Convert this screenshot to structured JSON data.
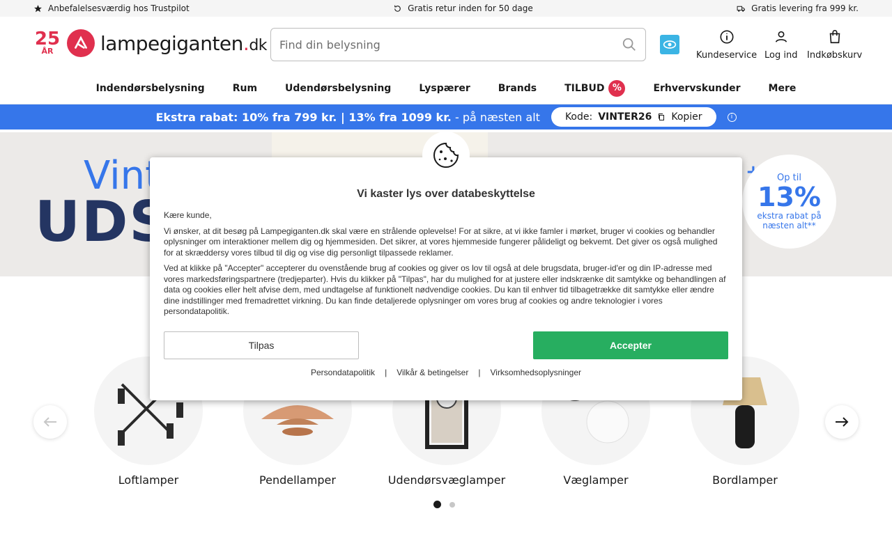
{
  "topbar": {
    "left": "Anbefalelsesværdig hos Trustpilot",
    "center": "Gratis retur inden for 50 dage",
    "right": "Gratis levering fra 999 kr."
  },
  "logo": {
    "years": "25",
    "years_sub": "ÅR",
    "name": "lampegiganten",
    "dot": ".",
    "tld": "dk"
  },
  "search": {
    "placeholder": "Find din belysning"
  },
  "header_links": {
    "customer_service": "Kundeservice",
    "login": "Log ind",
    "cart": "Indkøbskurv"
  },
  "nav": {
    "items": [
      "Indendørsbelysning",
      "Rum",
      "Udendørsbelysning",
      "Lyspærer",
      "Brands",
      "TILBUD",
      "Erhvervskunder",
      "Mere"
    ],
    "tilbud_badge": "%"
  },
  "promo": {
    "bold_text": "Ekstra rabat: 10% fra 799 kr. | 13% fra 1099 kr.",
    "rest_text": "- på næsten alt",
    "code_label": "Kode:",
    "code_value": "VINTER26",
    "copy_label": "Kopier"
  },
  "hero": {
    "title_small": "Vint",
    "title_big": "UDS",
    "badge_plus": "+",
    "badge_top": "Op til",
    "badge_pct": "13%",
    "badge_sub": "ekstra rabat på næsten alt**"
  },
  "categories": [
    {
      "label": "Loftlamper"
    },
    {
      "label": "Pendellamper"
    },
    {
      "label": "Udendørsvæglamper"
    },
    {
      "label": "Væglamper"
    },
    {
      "label": "Bordlamper"
    }
  ],
  "cookie_modal": {
    "title": "Vi kaster lys over databeskyttelse",
    "greeting": "Kære kunde,",
    "paragraph1": "Vi ønsker, at dit besøg på Lampegiganten.dk skal være en strålende oplevelse! For at sikre, at vi ikke famler i mørket, bruger vi cookies og behandler oplysninger om interaktioner mellem dig og hjemmesiden. Det sikrer, at vores hjemmeside fungerer pålideligt og bekvemt. Det giver os også mulighed for at skræddersy vores tilbud til dig og vise dig personligt tilpassede reklamer.",
    "paragraph2": "Ved at klikke på \"Accepter\" accepterer du ovenstående brug af cookies og giver os lov til også at dele brugsdata, bruger-id'er og din IP-adresse med vores markedsføringspartnere (tredjeparter). Hvis du klikker på \"Tilpas\", har du mulighed for at justere eller indskrænke dit samtykke og behandlingen af data og cookies eller helt afvise dem, med undtagelse af funktionelt nødvendige cookies. Du kan til enhver tid tilbagetrække dit samtykke eller ændre dine indstillinger med fremadrettet virkning. Du kan finde detaljerede oplysninger om vores brug af cookies og andre teknologier i vores persondatapolitik.",
    "customize_label": "Tilpas",
    "accept_label": "Accepter",
    "links": [
      "Persondatapolitik",
      "Vilkår & betingelser",
      "Virksomhedsoplysninger"
    ],
    "separator": "|"
  },
  "carousel": {
    "active_page": 1,
    "total_pages": 2
  },
  "colors": {
    "brand_red": "#e0304e",
    "promo_blue": "#3676ea",
    "accept_green": "#27ae60",
    "hero_navy": "#243562"
  }
}
